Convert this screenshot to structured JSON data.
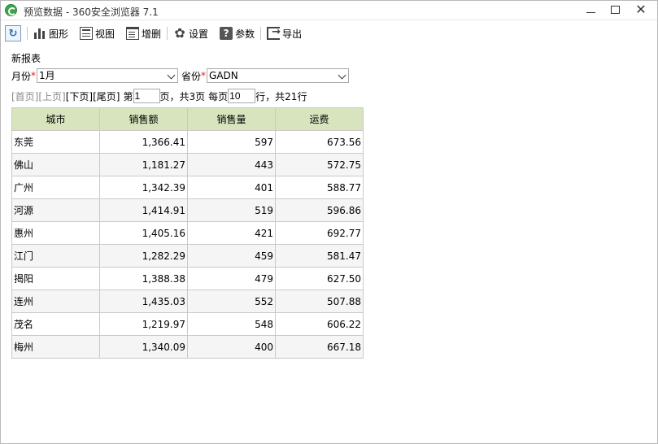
{
  "window": {
    "title": "预览数据 - 360安全浏览器 7.1",
    "minimize_glyph": "",
    "close_glyph": "✕"
  },
  "toolbar": {
    "refresh_glyph": "↻",
    "chart_label": "图形",
    "view_label": "视图",
    "crud_label": "增删",
    "settings_label": "设置",
    "params_label": "参数",
    "params_glyph": "?",
    "export_label": "导出",
    "gear_glyph": "✿"
  },
  "report": {
    "name": "新报表"
  },
  "filters": {
    "month_label": "月份",
    "month_value": "1月",
    "province_label": "省份",
    "province_value": "GADN",
    "required_mark": "*"
  },
  "pager": {
    "first": "[首页]",
    "prev": "[上页]",
    "next": "[下页]",
    "last": "[尾页]",
    "page_prefix": "第",
    "current_page": "1",
    "page_suffix": "页，共3页",
    "per_page_prefix": "每页",
    "page_size": "10",
    "rows_suffix": "行，共21行"
  },
  "table": {
    "columns": [
      "城市",
      "销售额",
      "销售量",
      "运费"
    ],
    "rows": [
      [
        "东莞",
        "1,366.41",
        "597",
        "673.56"
      ],
      [
        "佛山",
        "1,181.27",
        "443",
        "572.75"
      ],
      [
        "广州",
        "1,342.39",
        "401",
        "588.77"
      ],
      [
        "河源",
        "1,414.91",
        "519",
        "596.86"
      ],
      [
        "惠州",
        "1,405.16",
        "421",
        "692.77"
      ],
      [
        "江门",
        "1,282.29",
        "459",
        "581.47"
      ],
      [
        "揭阳",
        "1,388.38",
        "479",
        "627.50"
      ],
      [
        "连州",
        "1,435.03",
        "552",
        "507.88"
      ],
      [
        "茂名",
        "1,219.97",
        "548",
        "606.22"
      ],
      [
        "梅州",
        "1,340.09",
        "400",
        "667.18"
      ]
    ]
  },
  "colors": {
    "header_bg": "#d7e4bd",
    "required": "#e02020",
    "disabled_link": "#8a8a8a"
  }
}
